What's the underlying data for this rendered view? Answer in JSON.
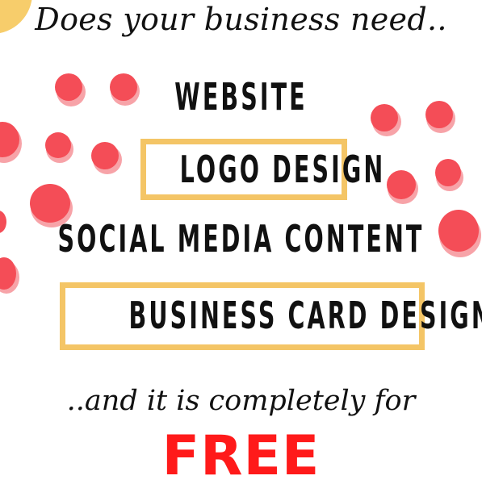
{
  "headline": "Does your business need..",
  "services": {
    "website": "WEBSITE",
    "logo_design": "LOGO DESIGN",
    "social_media": "SOCIAL MEDIA CONTENT",
    "business_card": "BUSINESS CARD DESIGN"
  },
  "tagline": "..and it is completely for",
  "free_label": "FREE",
  "colors": {
    "dot": "#f44d57",
    "dot_shadow": "#f7a3a8",
    "frame": "#f4c566",
    "corner": "#f7cd6b",
    "free": "#ff1a1a",
    "text": "#111111"
  }
}
